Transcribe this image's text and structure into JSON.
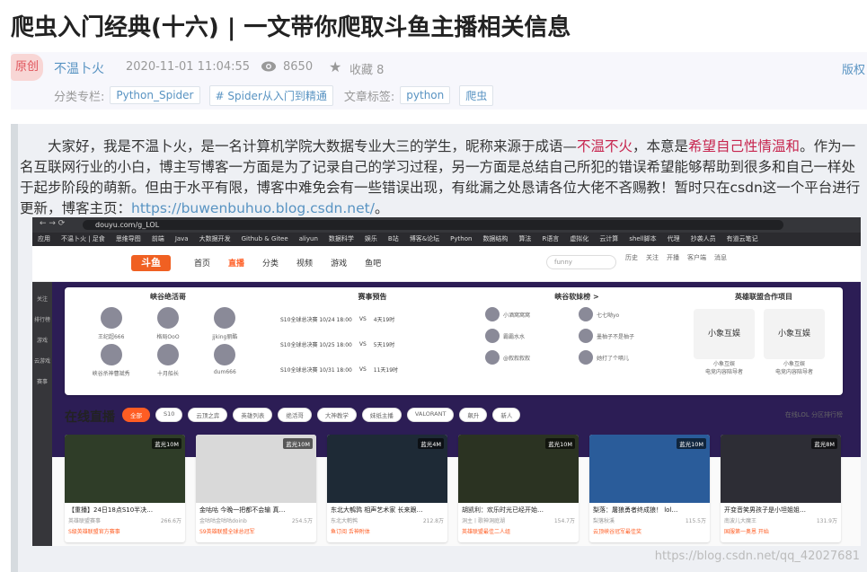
{
  "article": {
    "title": "爬虫入门经典(十六) | 一文带你爬取斗鱼主播相关信息",
    "original_badge": "原创",
    "author": "不温卜火",
    "date": "2020-11-01 11:04:55",
    "views": "8650",
    "favorites_label": "收藏 8",
    "copyright": "版权",
    "column_label": "分类专栏:",
    "columns": [
      "Python_Spider",
      "# Spider从入门到精通"
    ],
    "tags_label": "文章标签:",
    "tags": [
      "python",
      "爬虫"
    ]
  },
  "intro": {
    "part1": "大家好，我是不温卜火，是一名计算机学院大数据专业大三的学生，昵称来源于成语—",
    "red1": "不温不火",
    "part2": "，本意是",
    "red2": "希望自己性情温和",
    "part3": "。作为一名互联网行业的小白，博主写博客一方面是为了记录自己的学习过程，另一方面是总结自己所犯的错误希望能够帮助到很多和自己一样处于起步阶段的萌新。但由于水平有限，博客中难免会有一些错误出现，有纰漏之处恳请各位大佬不吝赐教！暂时只在csdn这一个平台进行更新，博客主页：",
    "link": "https://buwenbuhuo.blog.csdn.net/",
    "end": "。"
  },
  "screenshot": {
    "url": "douyu.com/g_LOL",
    "bookmarks": [
      "应用",
      "不温卜火 | 足食",
      "思维导图",
      "前端",
      "Java",
      "大数据开发",
      "Github & Gitee",
      "aliyun",
      "数据科学",
      "娱乐",
      "B站",
      "博客&论坛",
      "Python",
      "数据结构",
      "算法",
      "R语言",
      "虚拟化",
      "云计算",
      "shell脚本",
      "代理",
      "抄袭人员",
      "有道云笔记"
    ],
    "logo": "斗鱼",
    "nav": [
      "首页",
      "直播",
      "分类",
      "视频",
      "游戏",
      "鱼吧"
    ],
    "search": "funny",
    "top_icons": [
      "历史",
      "关注",
      "开播",
      "客户端",
      "消息"
    ],
    "side": [
      "关注",
      "排行榜",
      "游戏",
      "云游戏",
      "赛事"
    ],
    "cols": {
      "c1": {
        "title": "峡谷绝活哥",
        "names": [
          "王纪超666",
          "格局OoO",
          "jjking丽酷",
          "峡谷杀神曹斌秀",
          "十月船长",
          "dum666"
        ]
      },
      "c2": {
        "title": "赛事预告",
        "matches": [
          "S10全球总决赛 10/24 18:00",
          "S10全球总决赛 10/25 18:00",
          "S10全球总决赛 10/31 18:00"
        ],
        "times": [
          "4天19时",
          "5天19时",
          "11天19时"
        ]
      },
      "c3": {
        "title": "峡谷软妹榜 >",
        "names": [
          "小酒窝窝窝",
          "七七呦yo",
          "霸霸水水",
          "墨柚子不是柚子",
          "@叙叙叙叙",
          "她打了个嗝儿"
        ]
      },
      "c4": {
        "title": "英雄联盟合作项目",
        "items": [
          "小象互娱",
          "小象互娱"
        ],
        "sub": "电竞内容陪导者"
      }
    },
    "live_title": "在线直播",
    "filters": [
      "全部",
      "S10",
      "云顶之弈",
      "英雄列表",
      "绝活哥",
      "大神教学",
      "妹纸主播",
      "VALORANT",
      "飙升",
      "新人"
    ],
    "right_links": "在线LOL   分区排行榜",
    "tiles": [
      {
        "hot": "蓝光10M",
        "name": "【重播】24日18点S10半决…",
        "owner": "英雄联盟赛事",
        "count": "266.6万",
        "foot": "S级英雄联盟官方赛事"
      },
      {
        "hot": "蓝光10M",
        "name": "金咕咕 今晚一把都不会输 真…",
        "owner": "金咕咕金咕咕doinb",
        "count": "254.5万",
        "foot": "S9英雄联盟全球总冠军"
      },
      {
        "hot": "蓝光4M",
        "name": "东北大鹌鹑 相声艺术家 长来跟…",
        "owner": "东北大鹌鹑",
        "count": "212.8万",
        "foot": "鱼订阅 舌神附体"
      },
      {
        "hot": "蓝光10M",
        "name": "胡凯利：欢乐时光已经开始…",
        "owner": "洞主丨歌神洞庭湖",
        "count": "154.7万",
        "foot": "英雄联盟最佳二人组"
      },
      {
        "hot": "蓝光10M",
        "name": "梨落：屠狼勇者终成狼！ lol…",
        "owner": "梨落秋溪",
        "count": "115.5万",
        "foot": "云顶峡谷冠军最佳奖"
      },
      {
        "hot": "蓝光8M",
        "name": "开变音笑男孩子是小坦姐姐…",
        "owner": "南波儿大魔王",
        "count": "131.9万",
        "foot": "国服第一奥恩 开始"
      }
    ]
  },
  "watermark": "https://blog.csdn.net/qq_42027681"
}
